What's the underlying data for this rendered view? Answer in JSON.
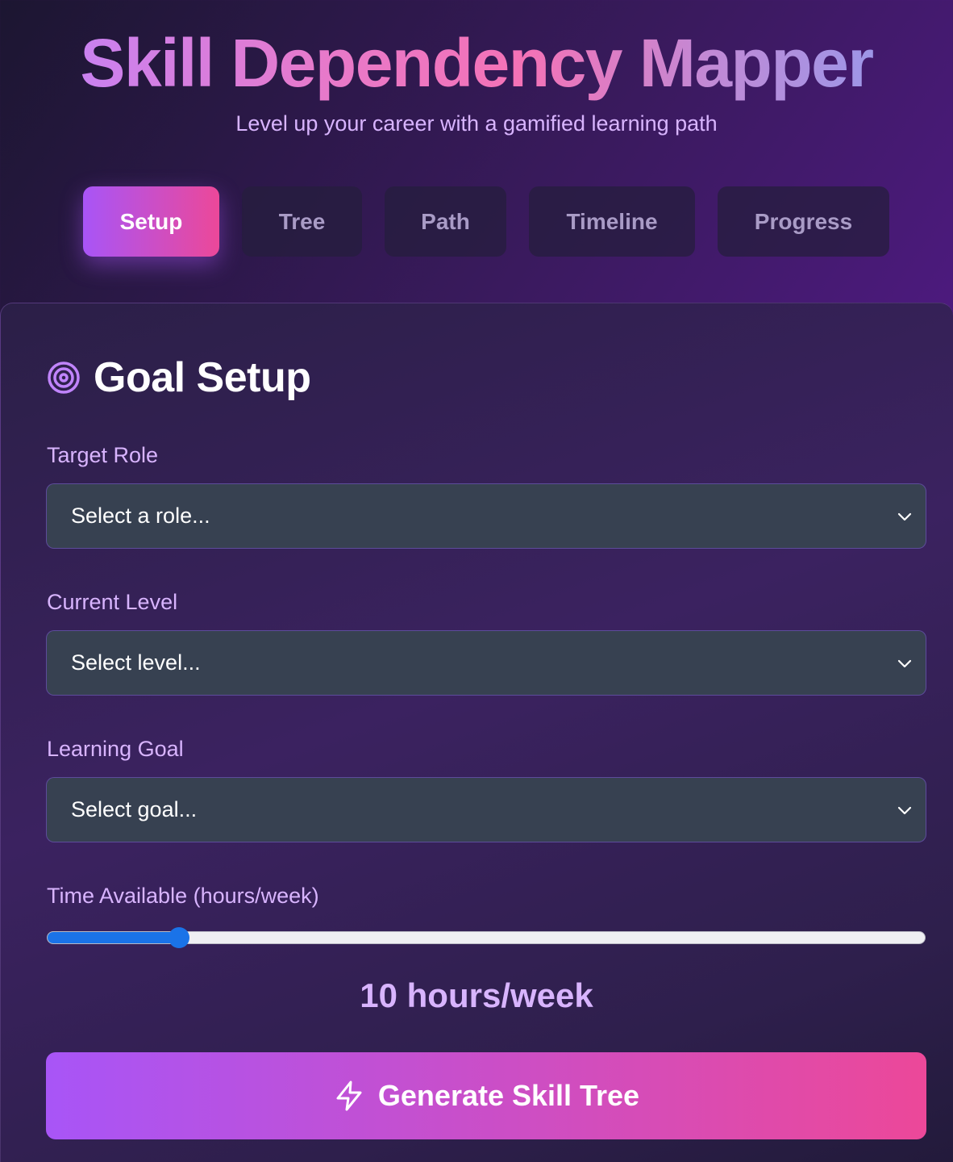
{
  "header": {
    "title": "Skill Dependency Mapper",
    "subtitle": "Level up your career with a gamified learning path"
  },
  "tabs": [
    {
      "label": "Setup",
      "active": true
    },
    {
      "label": "Tree",
      "active": false
    },
    {
      "label": "Path",
      "active": false
    },
    {
      "label": "Timeline",
      "active": false
    },
    {
      "label": "Progress",
      "active": false
    }
  ],
  "goal_setup": {
    "title": "Goal Setup",
    "icon": "target-icon",
    "target_role": {
      "label": "Target Role",
      "value": "Select a role..."
    },
    "current_level": {
      "label": "Current Level",
      "value": "Select level..."
    },
    "learning_goal": {
      "label": "Learning Goal",
      "value": "Select goal..."
    },
    "time_available": {
      "label": "Time Available (hours/week)",
      "value": 10,
      "slider_fraction": 0.15,
      "display": "10 hours/week"
    },
    "generate_button": {
      "label": "Generate Skill Tree",
      "icon": "lightning-bolt-icon"
    }
  },
  "colors": {
    "accent_start": "#a855f7",
    "accent_end": "#ec4899",
    "label": "#d8b4fe",
    "select_bg": "#374151",
    "slider": "#1a73e8"
  }
}
